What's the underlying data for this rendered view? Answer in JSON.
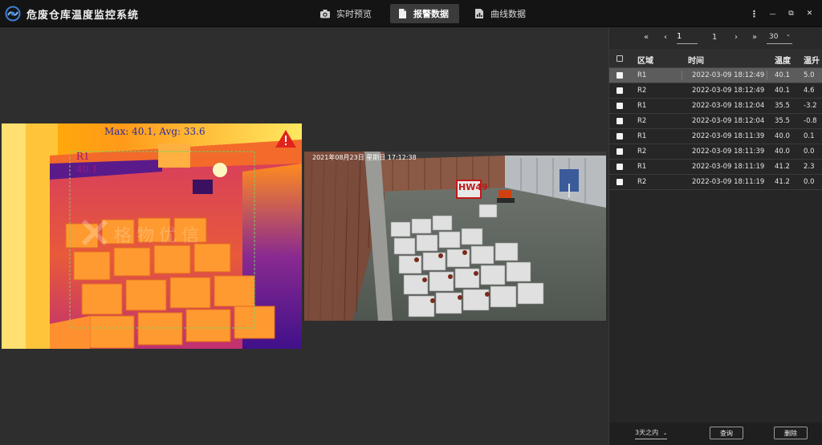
{
  "app": {
    "title": "危废仓库温度监控系统",
    "accent": "#3a7fd5"
  },
  "tabs": [
    {
      "label": "实时预览",
      "icon": "camera-icon",
      "active": false
    },
    {
      "label": "报警数据",
      "icon": "document-icon",
      "active": true
    },
    {
      "label": "曲线数据",
      "icon": "chart-icon",
      "active": false
    }
  ],
  "window": {
    "more": "⋮",
    "minimize": "—",
    "restore": "⧉",
    "close": "✕"
  },
  "thermal": {
    "summary": "Max: 40.1, Avg: 33.6",
    "region_label": "R1",
    "region_value": "40.1",
    "watermark": "格物优信",
    "warning_color": "#e0241c"
  },
  "camera": {
    "timestamp": "2021年08月23日 星期日 17:12:38",
    "sign": "HW49"
  },
  "pager": {
    "first": "«",
    "prev": "‹",
    "page_input": "1",
    "total_pages": "1",
    "next": "›",
    "last": "»",
    "page_size": "30",
    "page_size_arrow": "⌄"
  },
  "table": {
    "headers": {
      "area": "区域",
      "time": "时间",
      "temp": "温度",
      "rise": "温升"
    },
    "rows": [
      {
        "area": "R1",
        "time": "2022-03-09 18:12:49",
        "temp": "40.1",
        "rise": "5.0",
        "selected": true
      },
      {
        "area": "R2",
        "time": "2022-03-09 18:12:49",
        "temp": "40.1",
        "rise": "4.6",
        "selected": false
      },
      {
        "area": "R1",
        "time": "2022-03-09 18:12:04",
        "temp": "35.5",
        "rise": "-3.2",
        "selected": false
      },
      {
        "area": "R2",
        "time": "2022-03-09 18:12:04",
        "temp": "35.5",
        "rise": "-0.8",
        "selected": false
      },
      {
        "area": "R1",
        "time": "2022-03-09 18:11:39",
        "temp": "40.0",
        "rise": "0.1",
        "selected": false
      },
      {
        "area": "R2",
        "time": "2022-03-09 18:11:39",
        "temp": "40.0",
        "rise": "0.0",
        "selected": false
      },
      {
        "area": "R1",
        "time": "2022-03-09 18:11:19",
        "temp": "41.2",
        "rise": "2.3",
        "selected": false
      },
      {
        "area": "R2",
        "time": "2022-03-09 18:11:19",
        "temp": "41.2",
        "rise": "0.0",
        "selected": false
      }
    ]
  },
  "footer": {
    "range": "3天之内",
    "range_arrow": "⌄",
    "query": "查询",
    "delete": "删除"
  }
}
